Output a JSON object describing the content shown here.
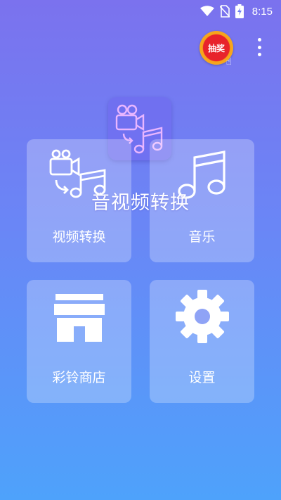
{
  "status_bar": {
    "time": "8:15"
  },
  "header": {
    "lottery_label": "抽奖"
  },
  "app": {
    "title": "音视频转换"
  },
  "tiles": [
    {
      "label": "视频转换",
      "icon": "video-to-music-icon"
    },
    {
      "label": "音乐",
      "icon": "music-note-icon"
    },
    {
      "label": "彩铃商店",
      "icon": "store-icon"
    },
    {
      "label": "设置",
      "icon": "gear-icon"
    }
  ],
  "colors": {
    "background_top": "#7b72ee",
    "background_bottom": "#4ea2fb",
    "lottery_red": "#e8232b",
    "lottery_ring": "#f5b623"
  }
}
